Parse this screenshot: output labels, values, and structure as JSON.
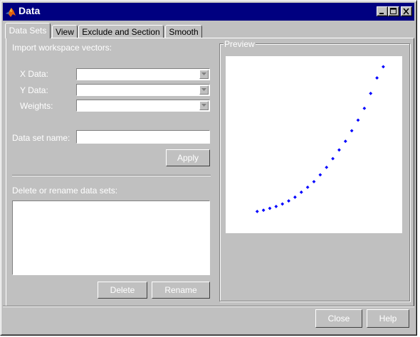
{
  "window": {
    "title": "Data",
    "title_icon": "matlab-logo-icon",
    "controls": [
      "minimize-icon",
      "maximize-icon",
      "close-icon"
    ]
  },
  "tabs": [
    {
      "label": "Data Sets",
      "active": true
    },
    {
      "label": "View",
      "active": false
    },
    {
      "label": "Exclude and Section",
      "active": false
    },
    {
      "label": "Smooth",
      "active": false
    }
  ],
  "import": {
    "heading": "Import workspace vectors:",
    "x_label": "X Data:",
    "y_label": "Y Data:",
    "weights_label": "Weights:",
    "x_value": "",
    "y_value": "",
    "weights_value": "",
    "dataset_name_label": "Data set name:",
    "dataset_name_value": "",
    "apply_label": "Apply"
  },
  "manage": {
    "heading": "Delete or rename data sets:",
    "datasets": [],
    "delete_label": "Delete",
    "rename_label": "Rename"
  },
  "preview": {
    "label": "Preview"
  },
  "footer": {
    "close_label": "Close",
    "help_label": "Help"
  },
  "colors": {
    "dialog_bg": "#c0c0c0",
    "titlebar": "#000080",
    "marker": "#0000ff"
  },
  "chart_data": {
    "type": "scatter",
    "x": [
      1,
      2,
      3,
      4,
      5,
      6,
      7,
      8,
      9,
      10,
      11,
      12,
      13,
      14,
      15,
      16,
      17,
      18,
      19,
      20,
      21
    ],
    "y": [
      0.05,
      0.07,
      0.1,
      0.13,
      0.17,
      0.22,
      0.28,
      0.36,
      0.44,
      0.53,
      0.64,
      0.76,
      0.9,
      1.04,
      1.18,
      1.35,
      1.52,
      1.71,
      1.95,
      2.2,
      2.38
    ],
    "xlim": [
      -4,
      24
    ],
    "ylim": [
      -0.3,
      2.55
    ],
    "grid": false
  }
}
